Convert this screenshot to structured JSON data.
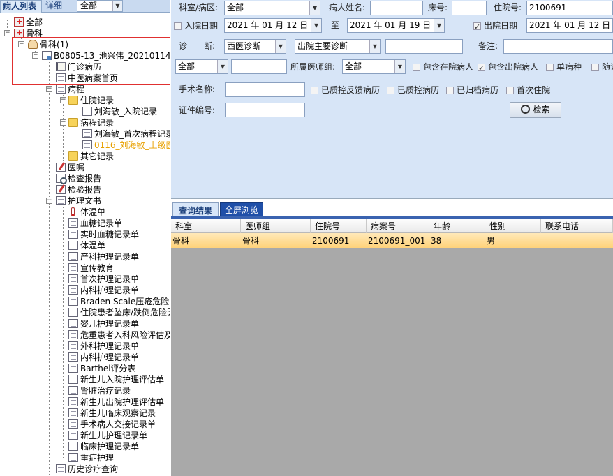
{
  "left": {
    "tabs": {
      "patients": "病人列表",
      "detail": "详细",
      "filter_value": "全部"
    },
    "tree": {
      "all": "全部",
      "orthopedics": "骨科",
      "orthopedics_group": "骨科(1)",
      "patient": "B0805-13_池兴伟_20210114",
      "outpatient": "门诊病历",
      "tcm_home": "中医病案首页",
      "course": "病程",
      "inpatient_records": "住院记录",
      "admission_record": "刘海敏_入院记录",
      "course_records": "病程记录",
      "first_course": "刘海敏_首次病程记录",
      "superior_round": "0116_刘海敏_上级医",
      "other_records": "其它记录",
      "orders": "医嘱",
      "exam_report": "检查报告",
      "lab_report": "检验报告",
      "nursing_docs": "护理文书",
      "nursing_items": [
        "体温单",
        "血糖记录单",
        "实时血糖记录单",
        "体温单",
        "产科护理记录单",
        "宣传教育",
        "首次护理记录单",
        "内科护理记录单",
        "Braden Scale压疮危险因素",
        "住院患者坠床/跌倒危险因素",
        "婴儿护理记录单",
        "危重患者入科风险评估及",
        "外科护理记录单",
        "内科护理记录单",
        "Barthel评分表",
        "新生儿入院护理评估单",
        "肾脏治疗记录",
        "新生儿出院护理评估单",
        "新生儿临床观察记录",
        "手术病人交接记录单",
        "新生儿护理记录单",
        "临床护理记录单",
        "重症护理"
      ],
      "history_query": "历史诊疗查询"
    }
  },
  "filter": {
    "dept_label": "科室/病区:",
    "dept_value": "全部",
    "name_label": "病人姓名:",
    "name_value": "",
    "bed_label": "床号:",
    "bed_value": "",
    "admno_label": "住院号:",
    "admno_value": "2100691",
    "admit_date_label": "入院日期",
    "admit_from": "2021 年 01 月 12 日",
    "to_label": "至",
    "admit_to": "2021 年 01 月 19 日",
    "discharge_label": "出院日期",
    "discharge_from": "2021 年 01 月 12 日",
    "diag_label": "诊　　断:",
    "diag_type": "西医诊断",
    "diag_kind": "出院主要诊断",
    "diag_value": "",
    "remark_label": "备注:",
    "remark_value": "",
    "scope_value": "全部",
    "scope_text": "",
    "doctor_group_label": "所属医师组:",
    "doctor_group_value": "全部",
    "chk_in_hospital": "包含在院病人",
    "chk_discharged": "包含出院病人",
    "chk_single_disease": "单病种",
    "chk_followup": "随访",
    "surgery_label": "手术名称:",
    "surgery_value": "",
    "chk_qc_feedback": "已质控反馈病历",
    "chk_qc": "已质控病历",
    "chk_archived": "已归档病历",
    "chk_first_admit": "首次住院",
    "cert_label": "证件编号:",
    "cert_value": "",
    "search_label": "检索"
  },
  "results": {
    "tab_result": "查询结果",
    "tab_full": "全屏浏览",
    "columns": [
      "科室",
      "医师组",
      "住院号",
      "病案号",
      "年龄",
      "性别",
      "联系电话"
    ],
    "rows": [
      [
        "骨科",
        "骨科",
        "2100691",
        "2100691_001",
        "38",
        "男",
        ""
      ]
    ]
  }
}
